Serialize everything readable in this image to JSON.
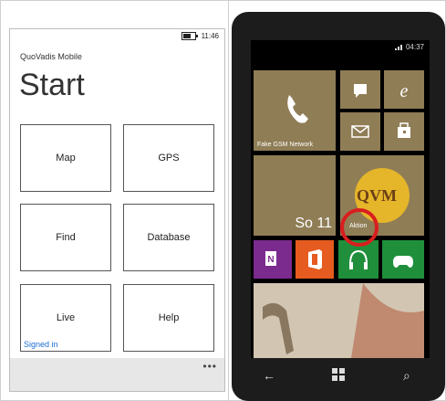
{
  "left_screen": {
    "status_time": "11:46",
    "app_title": "QuoVadis Mobile",
    "page_title": "Start",
    "tiles": [
      "Map",
      "GPS",
      "Find",
      "Database",
      "Live",
      "Help"
    ],
    "signed_in": "Signed in",
    "appbar_more": "•••"
  },
  "right_phone": {
    "status_time": "04:37",
    "fake_gsm_label": "Fake GSM Network",
    "calendar_date": "So 11",
    "qvm_label": "QVM",
    "aktion_label": "Aktion",
    "nav": {
      "back": "←",
      "search": "⌕"
    }
  }
}
